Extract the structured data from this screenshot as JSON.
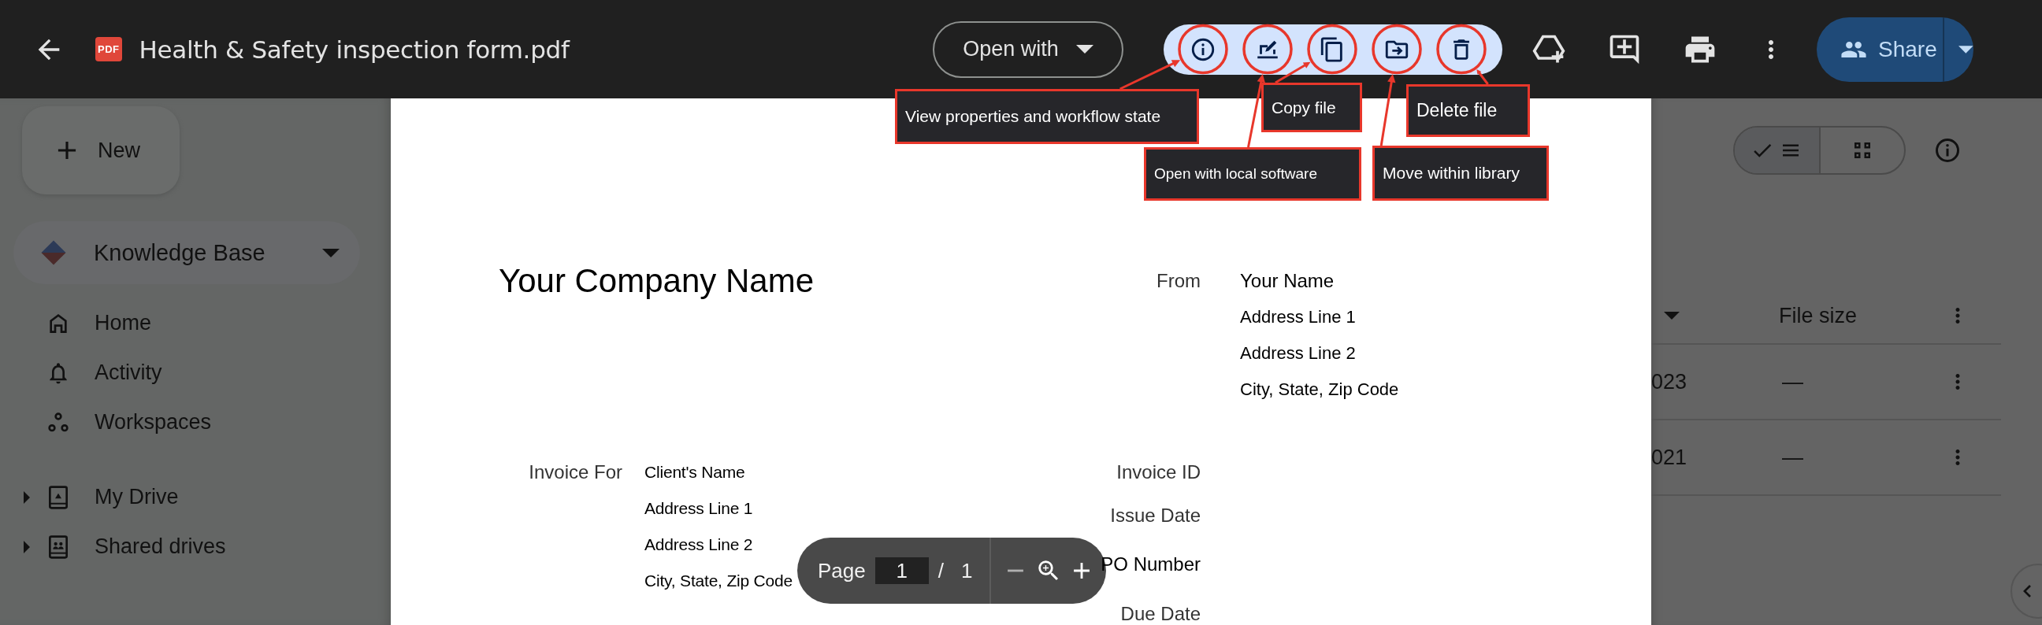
{
  "header": {
    "file_badge": "PDF",
    "title": "Health & Safety inspection form.pdf",
    "open_with": "Open with",
    "share": "Share",
    "actions": [
      {
        "kind": "info"
      },
      {
        "kind": "local-edit"
      },
      {
        "kind": "copy"
      },
      {
        "kind": "move"
      },
      {
        "kind": "delete"
      }
    ],
    "callouts": [
      {
        "kind": "info",
        "label": "View properties and workflow state"
      },
      {
        "kind": "copy",
        "label": "Copy file"
      },
      {
        "kind": "delete",
        "label": "Delete file"
      },
      {
        "kind": "local-edit",
        "label": "Open with local software"
      },
      {
        "kind": "move",
        "label": "Move within library"
      }
    ]
  },
  "sidebar": {
    "new_button": "New",
    "library": "Knowledge Base",
    "items": [
      {
        "kind": "home",
        "label": "Home"
      },
      {
        "kind": "activity",
        "label": "Activity"
      },
      {
        "kind": "workspaces",
        "label": "Workspaces"
      },
      {
        "kind": "my-drive",
        "label": "My Drive",
        "expanded": false
      },
      {
        "kind": "shared-drives",
        "label": "Shared drives",
        "expanded": false
      }
    ]
  },
  "document": {
    "company": "Your Company Name",
    "from_label": "From",
    "from_lines": [
      "Your Name",
      "Address Line 1",
      "Address Line 2",
      "City, State, Zip Code"
    ],
    "invoice_for_label": "Invoice For",
    "client_lines": [
      "Client's Name",
      "Address Line 1",
      "Address Line 2",
      "City, State, Zip Code"
    ],
    "fields": [
      "Invoice ID",
      "Issue Date",
      "PO Number",
      "Due Date"
    ]
  },
  "page_bar": {
    "label": "Page",
    "current": "1",
    "separator": "/",
    "total": "1"
  },
  "file_list": {
    "views": [
      {
        "kind": "list",
        "selected": true
      },
      {
        "kind": "grid",
        "selected": false
      }
    ],
    "columns": [
      "File size"
    ],
    "rows": [
      {
        "column_1": "023",
        "size": "—"
      },
      {
        "column_1": "021",
        "size": "—"
      }
    ]
  }
}
